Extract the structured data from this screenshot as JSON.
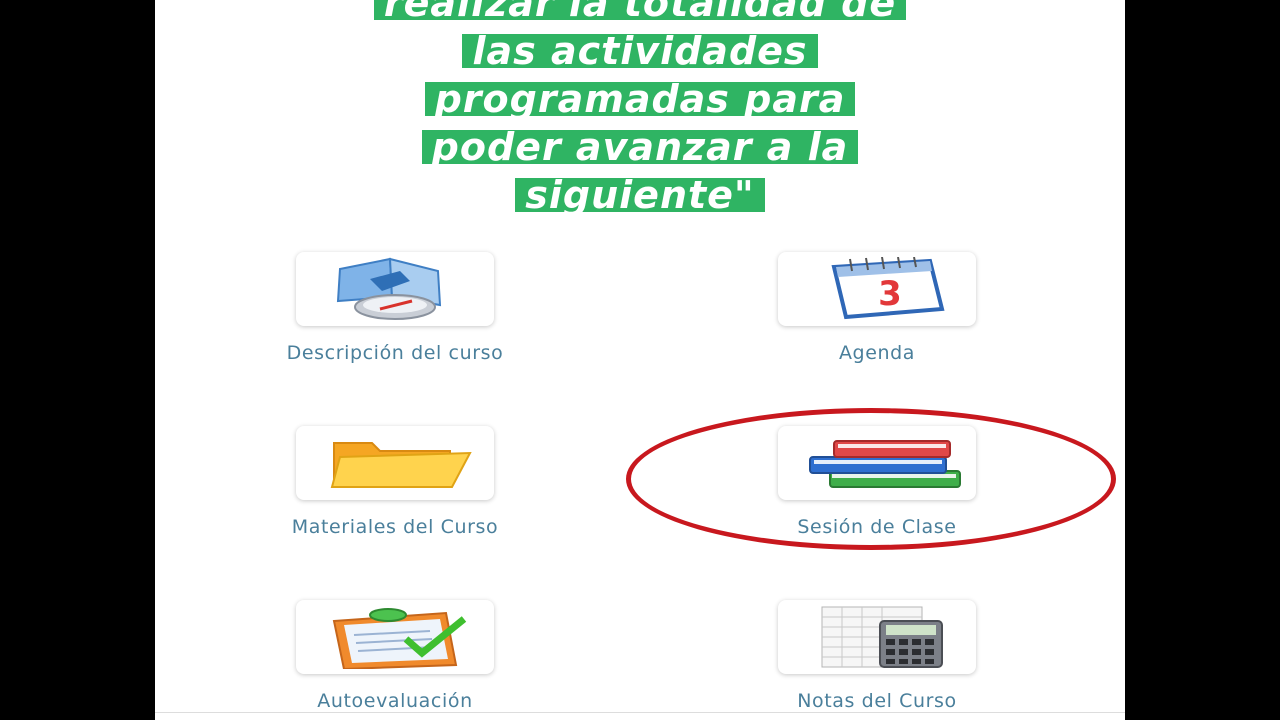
{
  "banner": {
    "lines": [
      "realizar la totalidad de",
      "las actividades",
      "programadas para",
      "poder avanzar a la",
      "siguiente\""
    ]
  },
  "tiles": [
    {
      "label": "Descripción del curso",
      "icon": "compass-map-icon"
    },
    {
      "label": "Agenda",
      "icon": "calendar-icon"
    },
    {
      "label": "Materiales del Curso",
      "icon": "folder-icon"
    },
    {
      "label": "Sesión de Clase",
      "icon": "books-icon"
    },
    {
      "label": "Autoevaluación",
      "icon": "checklist-clipboard-icon"
    },
    {
      "label": "Notas del Curso",
      "icon": "calculator-spreadsheet-icon"
    }
  ],
  "calendar": {
    "day": "3"
  },
  "colors": {
    "banner": "#2fb463",
    "highlight": "#c8181e",
    "label": "#4a7f9b"
  }
}
